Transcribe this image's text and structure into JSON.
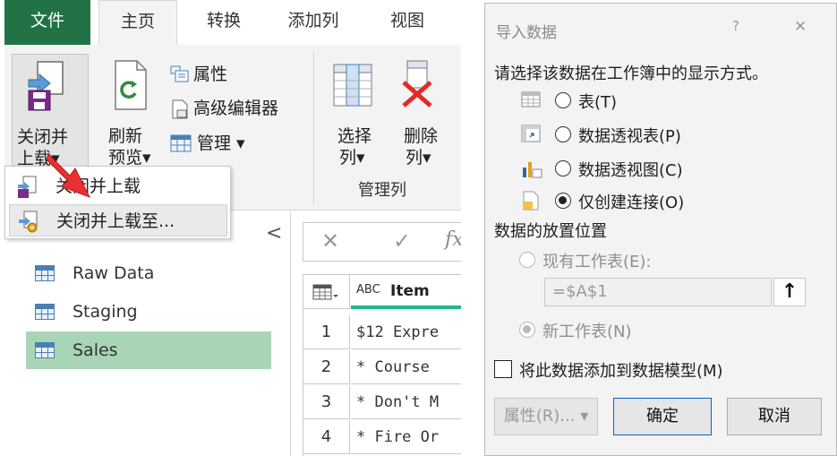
{
  "ribbon": {
    "tabs": [
      {
        "label": "文件"
      },
      {
        "label": "主页"
      },
      {
        "label": "转换"
      },
      {
        "label": "添加列"
      },
      {
        "label": "视图"
      }
    ],
    "close_load": {
      "line1": "关闭并",
      "line2": "上载▾"
    },
    "refresh": {
      "line1": "刷新",
      "line2": "预览▾"
    },
    "properties": "属性",
    "advanced_editor": "高级编辑器",
    "manage": "管理 ▾",
    "choose_columns": {
      "line1": "选择",
      "line2": "列▾"
    },
    "remove_columns": {
      "line1": "删除",
      "line2": "列▾"
    },
    "group_manage_columns": "管理列"
  },
  "close_menu": {
    "items": [
      {
        "label": "关闭并上载"
      },
      {
        "label": "关闭并上载至..."
      }
    ]
  },
  "queries": {
    "collapse_glyph": "<",
    "items": [
      {
        "label": "Raw Data",
        "selected": false
      },
      {
        "label": "Staging",
        "selected": false
      },
      {
        "label": "Sales",
        "selected": true
      }
    ]
  },
  "formula_bar": {
    "cancel": "✕",
    "confirm": "✓",
    "fx": "fx"
  },
  "grid": {
    "column_type": "ABC",
    "column_header": "Item",
    "rows": [
      {
        "num": "1",
        "item": "$12 Expre"
      },
      {
        "num": "2",
        "item": "* Course"
      },
      {
        "num": "3",
        "item": "* Don't M"
      },
      {
        "num": "4",
        "item": "* Fire Or"
      }
    ]
  },
  "dialog": {
    "title": "导入数据",
    "help": "?",
    "close": "✕",
    "choose_view_label": "请选择该数据在工作簿中的显示方式。",
    "view_options": [
      {
        "label": "表(T)",
        "selected": false
      },
      {
        "label": "数据透视表(P)",
        "selected": false
      },
      {
        "label": "数据透视图(C)",
        "selected": false
      },
      {
        "label": "仅创建连接(O)",
        "selected": true
      }
    ],
    "location_label": "数据的放置位置",
    "location_options": [
      {
        "label": "现有工作表(E):",
        "selected": false
      },
      {
        "label": "新工作表(N)",
        "selected": true
      }
    ],
    "reference_value": "=$A$1",
    "reference_button": "↑",
    "add_to_model": {
      "label": "将此数据添加到数据模型(M)",
      "checked": false
    },
    "buttons": {
      "properties": "属性(R)... ▾",
      "ok": "确定",
      "cancel": "取消"
    }
  },
  "colors": {
    "file_tab": "#217346",
    "selected_query": "#a8d5b5",
    "ok_border": "#0a64c8"
  }
}
